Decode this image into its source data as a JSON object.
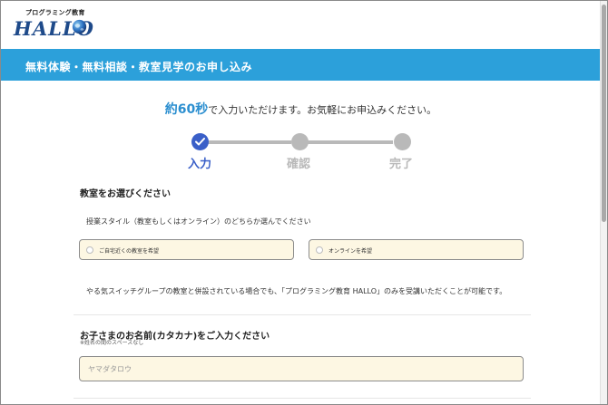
{
  "header": {
    "logo_subtitle": "プログラミング教育",
    "logo_text": "HALLO"
  },
  "banner": {
    "title": "無料体験・無料相談・教室見学のお申し込み"
  },
  "lead": {
    "highlight": "約60秒",
    "rest": "で入力いただけます。お気軽にお申込みください。"
  },
  "steps": [
    {
      "label": "入力",
      "active": true
    },
    {
      "label": "確認",
      "active": false
    },
    {
      "label": "完了",
      "active": false
    }
  ],
  "classroom": {
    "title": "教室をお選びください",
    "instruction": "授業スタイル（教室もしくはオンライン）のどちらか選んでください",
    "options": [
      {
        "label": "ご自宅近くの教室を希望"
      },
      {
        "label": "オンラインを希望"
      }
    ],
    "note": "やる気スイッチグループの教室と併設されている場合でも、「プログラミング教育 HALLO」のみを受講いただくことが可能です。"
  },
  "child_name": {
    "title": "お子さまのお名前(カタカナ)をご入力ください",
    "hint": "※姓名の間のスペースなし",
    "placeholder": "ヤマダタロウ"
  },
  "colors": {
    "banner": "#2ca0da",
    "step_active": "#3a5fc8",
    "step_inactive": "#b9b9b9",
    "highlight": "#2c8fd0",
    "field_bg": "#fdf7e3"
  }
}
